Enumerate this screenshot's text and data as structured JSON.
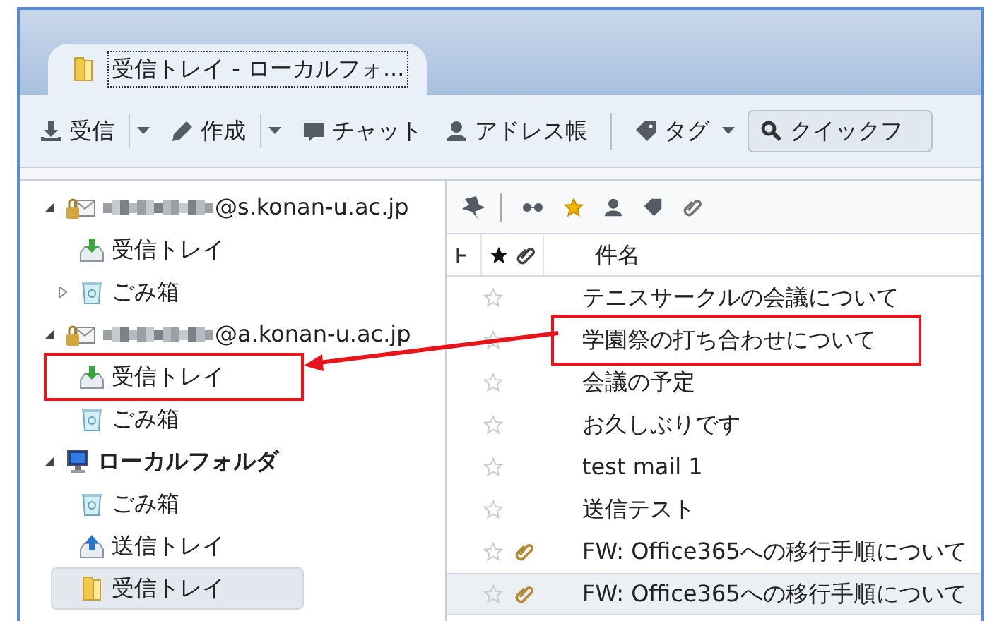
{
  "tab": {
    "title": "受信トレイ - ローカルフォ...",
    "selected": true
  },
  "toolbar": [
    {
      "label": "受信",
      "kind": "get",
      "dropdown": true
    },
    {
      "label": "作成",
      "kind": "write",
      "dropdown": true
    },
    {
      "label": "チャット",
      "kind": "chat",
      "dropdown": false
    },
    {
      "label": "アドレス帳",
      "kind": "contacts",
      "dropdown": false
    },
    {
      "label": "タグ",
      "kind": "tag",
      "dropdown": true
    },
    {
      "label": "クイックフ",
      "kind": "search",
      "dropdown": false
    }
  ],
  "folders": [
    {
      "name": "@s.konan-u.ac.jp",
      "kind": "account",
      "redacted": true,
      "expanded": true,
      "selected": false,
      "highlighted": false,
      "children": [
        {
          "name": "受信トレイ",
          "kind": "inbox",
          "selected": false,
          "highlighted": false
        },
        {
          "name": "ごみ箱",
          "kind": "trash",
          "expanded": false,
          "selected": false,
          "highlighted": false
        }
      ]
    },
    {
      "name": "@a.konan-u.ac.jp",
      "kind": "account",
      "redacted": true,
      "expanded": true,
      "selected": false,
      "highlighted": false,
      "children": [
        {
          "name": "受信トレイ",
          "kind": "inbox",
          "selected": false,
          "highlighted": true
        },
        {
          "name": "ごみ箱",
          "kind": "trash",
          "selected": false,
          "highlighted": false
        }
      ]
    },
    {
      "name": "ローカルフォルダ",
      "kind": "local",
      "redacted": false,
      "expanded": true,
      "selected": false,
      "highlighted": false,
      "children": [
        {
          "name": "ごみ箱",
          "kind": "trash",
          "selected": false,
          "highlighted": false
        },
        {
          "name": "送信トレイ",
          "kind": "outbox",
          "selected": false,
          "highlighted": false
        },
        {
          "name": "受信トレイ",
          "kind": "folder",
          "selected": true,
          "highlighted": false
        }
      ]
    }
  ],
  "columns": {
    "subject": "件名"
  },
  "messages": [
    {
      "subject": "テニスサークルの会議について",
      "starred": false,
      "attachment": false,
      "selected": false,
      "highlighted": false
    },
    {
      "subject": "学園祭の打ち合わせについて",
      "starred": false,
      "attachment": false,
      "selected": false,
      "highlighted": true
    },
    {
      "subject": "会議の予定",
      "starred": false,
      "attachment": false,
      "selected": false,
      "highlighted": false
    },
    {
      "subject": "お久しぶりです",
      "starred": false,
      "attachment": false,
      "selected": false,
      "highlighted": false
    },
    {
      "subject": "test mail 1",
      "starred": false,
      "attachment": false,
      "selected": false,
      "highlighted": false
    },
    {
      "subject": "送信テスト",
      "starred": false,
      "attachment": false,
      "selected": false,
      "highlighted": false
    },
    {
      "subject": "FW: Office365への移行手順について",
      "starred": false,
      "attachment": true,
      "selected": false,
      "highlighted": false
    },
    {
      "subject": "FW: Office365への移行手順について",
      "starred": false,
      "attachment": true,
      "selected": true,
      "highlighted": false
    }
  ]
}
